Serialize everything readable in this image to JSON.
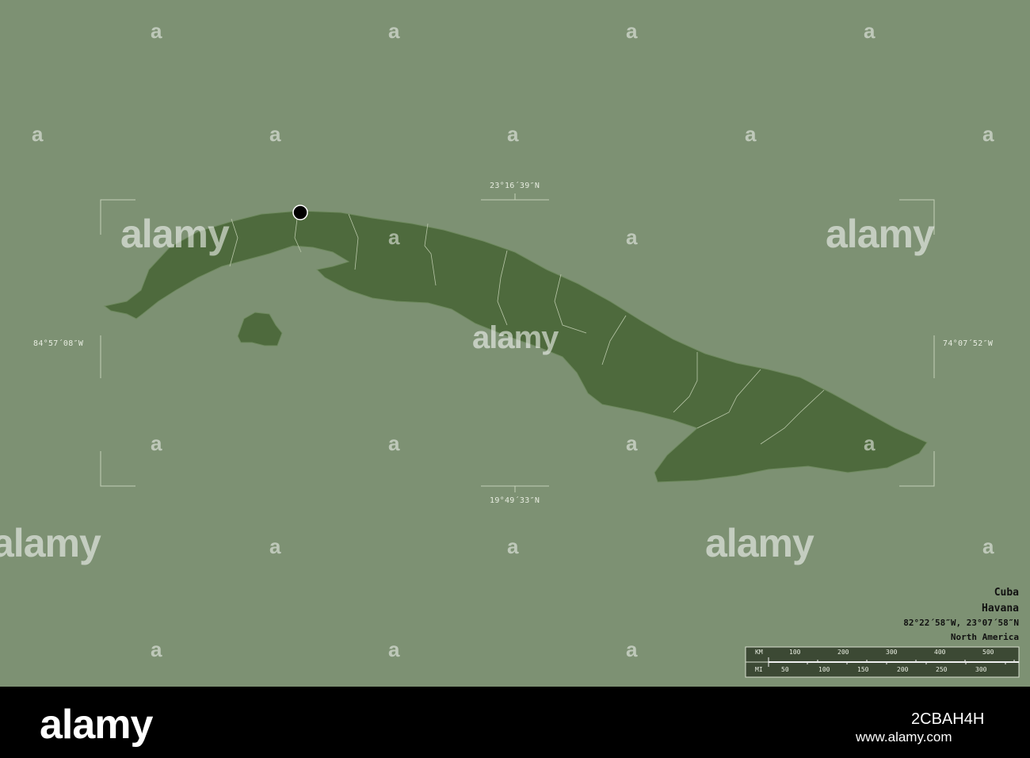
{
  "map": {
    "coords": {
      "north": "23°16´39″N",
      "south": "19°49´33″N",
      "west": "84°57´08″W",
      "east": "74°07´52″W"
    },
    "info": {
      "country": "Cuba",
      "region": "Havana",
      "position": "82°22´58″W, 23°07´58″N",
      "continent": "North America"
    },
    "scale": {
      "km_label": "KM",
      "km_ticks": [
        "100",
        "200",
        "300",
        "400",
        "500"
      ],
      "mi_label": "MI",
      "mi_ticks": [
        "50",
        "100",
        "150",
        "200",
        "250",
        "300"
      ]
    },
    "colors": {
      "background": "#7d9173",
      "land": "#4e6a3d",
      "marker": "#000000"
    },
    "watermark": "alamy",
    "watermark_mark": "a"
  },
  "footer": {
    "logo": "alamy",
    "image_id": "2CBAH4H",
    "url": "www.alamy.com"
  }
}
